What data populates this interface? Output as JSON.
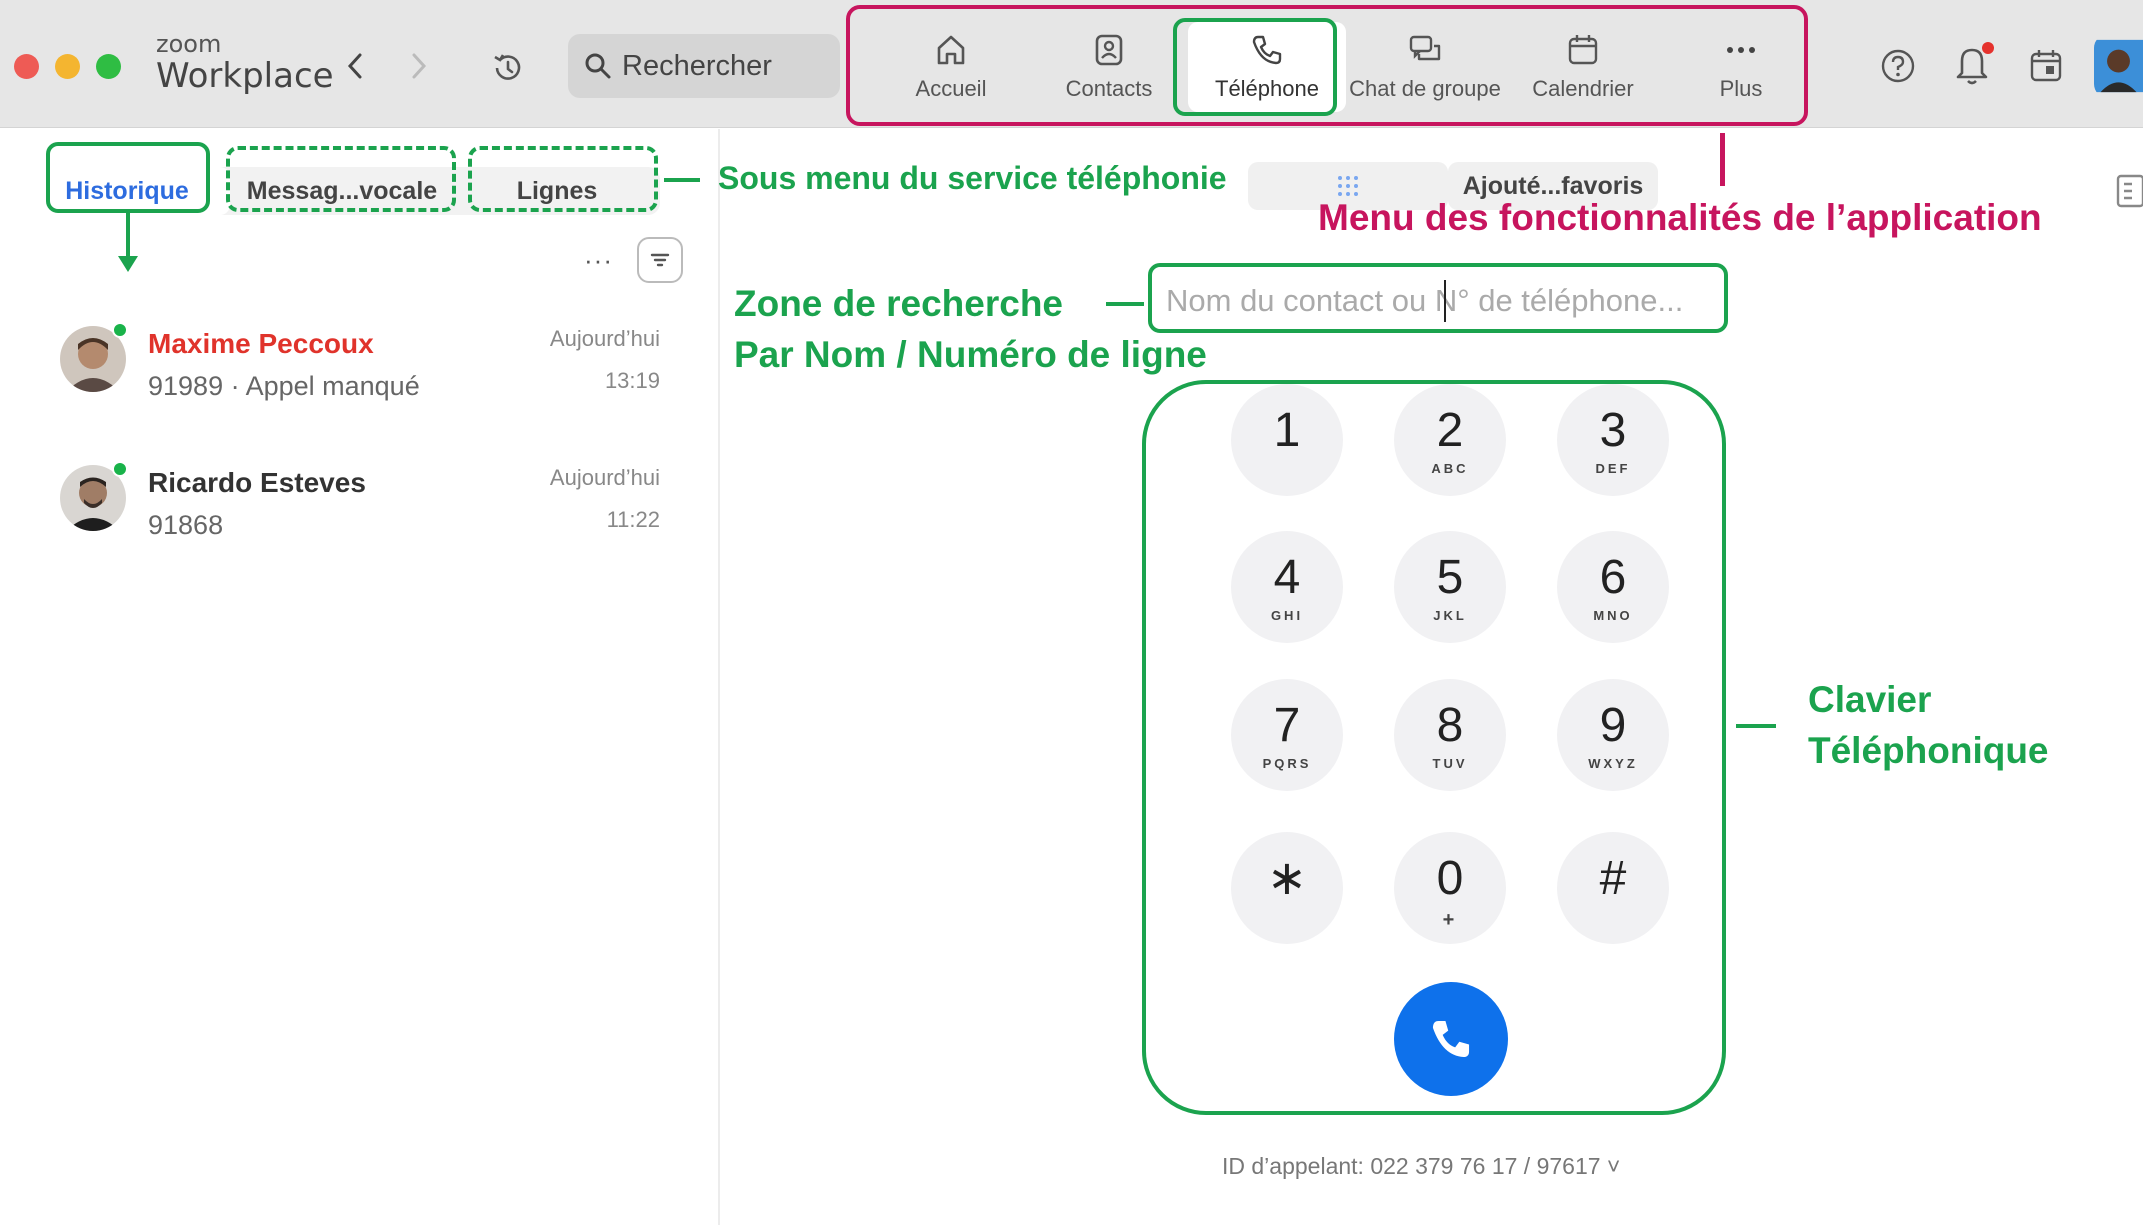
{
  "app": {
    "logo_top": "zoom",
    "logo_bottom": "Workplace"
  },
  "colors": {
    "accent_green": "#1ba34e",
    "accent_magenta": "#c7155e",
    "call_blue": "#0e71eb",
    "missed_red": "#e0332b",
    "link_blue": "#2d6cdf"
  },
  "titlebar": {
    "back_icon": "chevron-left-icon",
    "forward_icon": "chevron-right-icon",
    "history_icon": "clock-history-icon",
    "search_label": "Rechercher",
    "nav": [
      {
        "label": "Accueil",
        "icon": "home-icon"
      },
      {
        "label": "Contacts",
        "icon": "contacts-icon"
      },
      {
        "label": "Téléphone",
        "icon": "phone-icon",
        "active": true
      },
      {
        "label": "Chat de groupe",
        "icon": "chat-icon"
      },
      {
        "label": "Calendrier",
        "icon": "calendar-icon"
      },
      {
        "label": "Plus",
        "icon": "more-icon"
      }
    ],
    "right_icons": [
      "help-icon",
      "bell-icon",
      "calendar-today-icon",
      "avatar"
    ]
  },
  "phone": {
    "subtabs": [
      {
        "label": "Historique",
        "active": true
      },
      {
        "label": "Messag...vocale"
      },
      {
        "label": "Lignes"
      }
    ],
    "list_more": "···",
    "calls": [
      {
        "name": "Maxime Peccoux",
        "detail": "91989 · Appel manqué",
        "date": "Aujourd’hui",
        "time": "13:19",
        "missed": true
      },
      {
        "name": "Ricardo Esteves",
        "detail": "91868",
        "date": "Aujourd’hui",
        "time": "11:22",
        "missed": false
      }
    ],
    "right_tabs": {
      "favorites": "Ajouté...favoris"
    },
    "search_placeholder": "Nom du contact ou N° de téléphone...",
    "keypad": [
      {
        "digit": "1",
        "letters": ""
      },
      {
        "digit": "2",
        "letters": "ABC"
      },
      {
        "digit": "3",
        "letters": "DEF"
      },
      {
        "digit": "4",
        "letters": "GHI"
      },
      {
        "digit": "5",
        "letters": "JKL"
      },
      {
        "digit": "6",
        "letters": "MNO"
      },
      {
        "digit": "7",
        "letters": "PQRS"
      },
      {
        "digit": "8",
        "letters": "TUV"
      },
      {
        "digit": "9",
        "letters": "WXYZ"
      },
      {
        "digit": "∗",
        "letters": ""
      },
      {
        "digit": "0",
        "letters": "+"
      },
      {
        "digit": "#",
        "letters": ""
      }
    ],
    "caller_id": "ID d’appelant: 022 379 76 17 / 97617 ˅"
  },
  "annotations": {
    "submenu": "Sous menu du service téléphonie",
    "features_menu": "Menu des fonctionnalités de l’application",
    "search_zone_line1": "Zone de recherche",
    "search_zone_line2": "Par Nom / Numéro de ligne",
    "keypad_line1": "Clavier",
    "keypad_line2": "Téléphonique"
  }
}
